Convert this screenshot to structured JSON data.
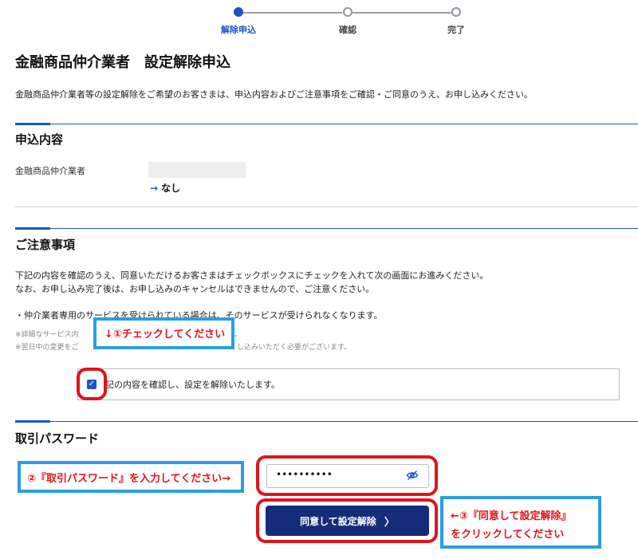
{
  "stepper": {
    "steps": [
      {
        "label": "解除申込",
        "state": "active"
      },
      {
        "label": "確認",
        "state": "inactive"
      },
      {
        "label": "完了",
        "state": "inactive"
      }
    ]
  },
  "page": {
    "title": "金融商品仲介業者　設定解除申込",
    "description": "金融商品仲介業者等の設定解除をご希望のお客さまは、申込内容およびご注意事項をご確認・ご同意のうえ、お申し込みください。"
  },
  "application": {
    "section_title": "申込内容",
    "field_label": "金融商品仲介業者",
    "field_current_value": "",
    "new_value_arrow": "→",
    "new_value": "なし"
  },
  "notice": {
    "section_title": "ご注意事項",
    "line1": "下記の内容を確認のうえ、同意いただけるお客さまはチェックボックスにチェックを入れて次の画面にお進みください。",
    "line2": "なお、お申し込み完了後は、お申し込みのキャンセルはできませんので、ご注意ください。",
    "bullet": "・仲介業者専用のサービスを受けられている場合は、そのサービスが受けられなくなります。",
    "note1": "※詳細なサービス内",
    "note1_tail": "。",
    "note2": "※翌日中の変更をご",
    "note2_tail": "し込みいただく必要がございます。",
    "agree_label": "記の内容を確認し、設定を解除いたします。",
    "agree_checked": true
  },
  "password": {
    "section_title": "取引パスワード",
    "masked_value": "••••••••••",
    "submit_label": "同意して設定解除",
    "submit_chevron": "〉"
  },
  "annotations": {
    "step1": "↓①チェックしてください",
    "step2": "②『取引パスワード』を入力してください→",
    "step3_line1": "←③『同意して設定解除』",
    "step3_line2": "をクリックしてください"
  },
  "colors": {
    "primary_blue": "#1a56c4",
    "button_navy": "#142c7a",
    "annotation_red": "#e0141b",
    "annotation_blue": "#2b9fe0"
  }
}
